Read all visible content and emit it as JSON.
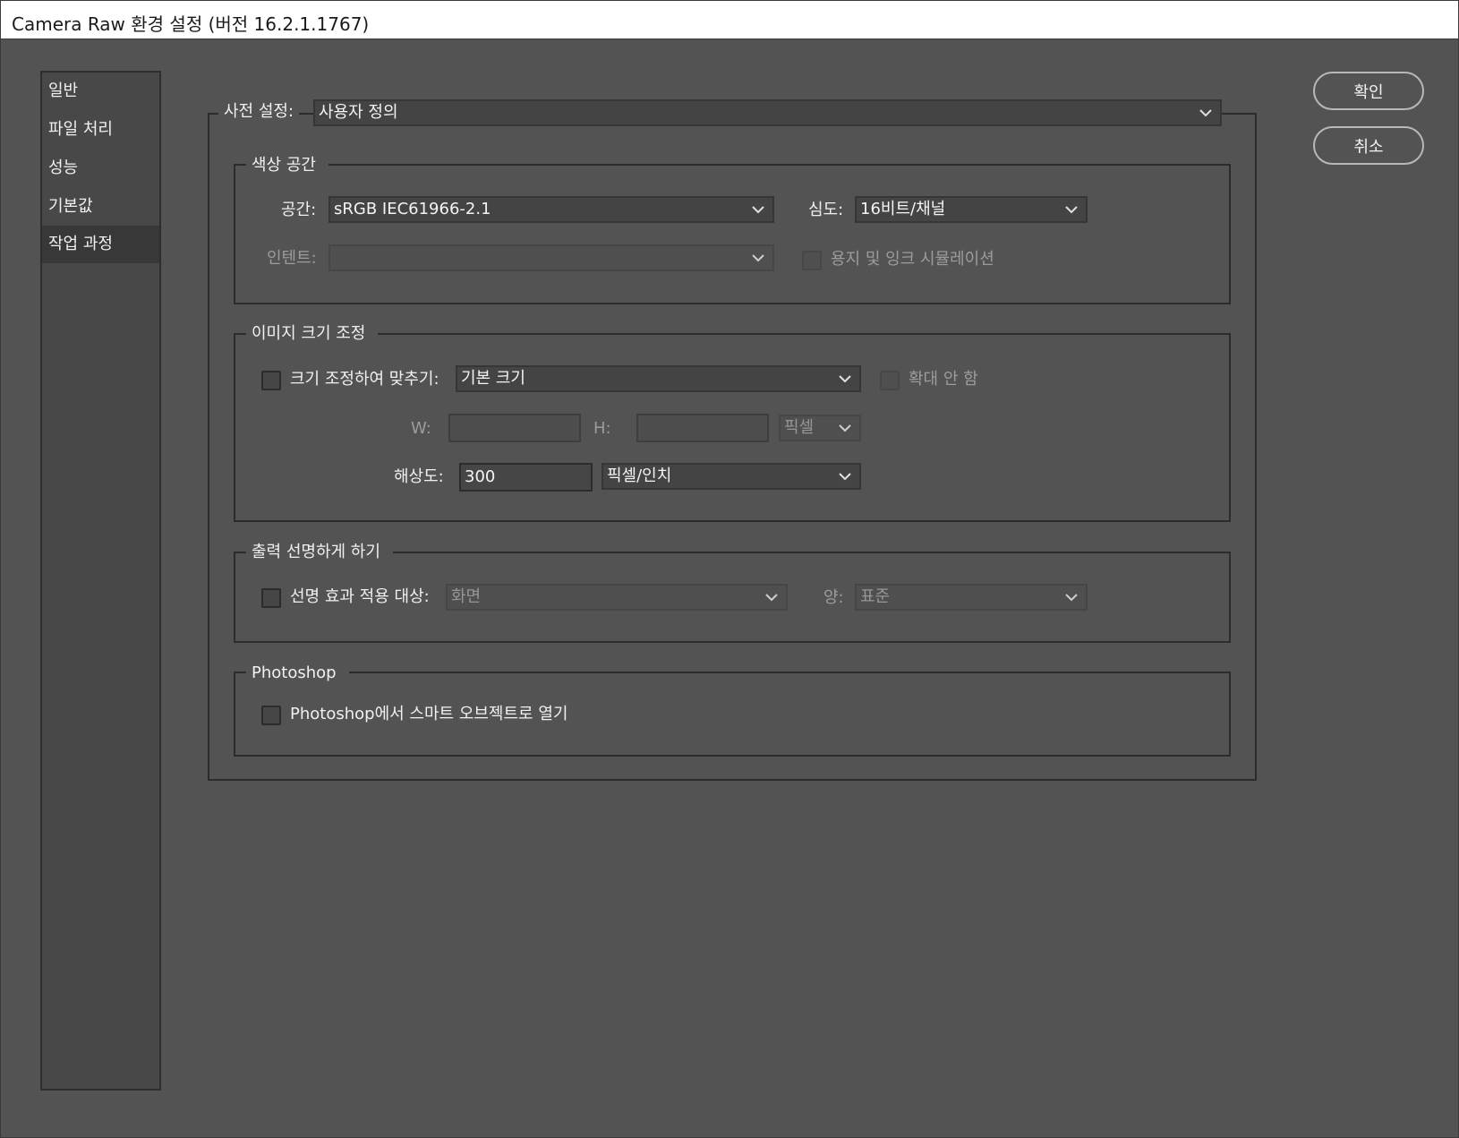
{
  "window": {
    "title": "Camera Raw 환경 설정  (버전 16.2.1.1767)"
  },
  "sidebar": {
    "items": [
      {
        "label": "일반"
      },
      {
        "label": "파일 처리"
      },
      {
        "label": "성능"
      },
      {
        "label": "기본값"
      },
      {
        "label": "작업 과정",
        "active": true
      }
    ]
  },
  "buttons": {
    "ok": "확인",
    "cancel": "취소"
  },
  "preset": {
    "label": "사전 설정:",
    "value": "사용자 정의"
  },
  "color_space": {
    "legend": "색상 공간",
    "space_label": "공간:",
    "space_value": "sRGB IEC61966-2.1",
    "depth_label": "심도:",
    "depth_value": "16비트/채널",
    "intent_label": "인텐트:",
    "intent_value": "",
    "simulate_label": "용지 및 잉크 시뮬레이션",
    "simulate_checked": false
  },
  "image_sizing": {
    "legend": "이미지 크기 조정",
    "resize_label": "크기 조정하여 맞추기:",
    "resize_checked": false,
    "resize_value": "기본 크기",
    "no_enlarge_label": "확대 안 함",
    "no_enlarge_checked": false,
    "w_label": "W:",
    "w_value": "",
    "h_label": "H:",
    "h_value": "",
    "unit_value": "픽셀",
    "resolution_label": "해상도:",
    "resolution_value": "300",
    "resolution_unit": "픽셀/인치"
  },
  "sharpening": {
    "legend": "출력 선명하게 하기",
    "sharpen_label": "선명 효과 적용 대상:",
    "sharpen_checked": false,
    "sharpen_value": "화면",
    "amount_label": "양:",
    "amount_value": "표준"
  },
  "photoshop": {
    "legend": "Photoshop",
    "smart_object_label": "Photoshop에서 스마트 오브젝트로 열기",
    "smart_object_checked": false
  },
  "colors": {
    "background": "#535353",
    "sidebar_bg": "#484848",
    "sidebar_active": "#383838",
    "titlebar": "#ffffff"
  }
}
